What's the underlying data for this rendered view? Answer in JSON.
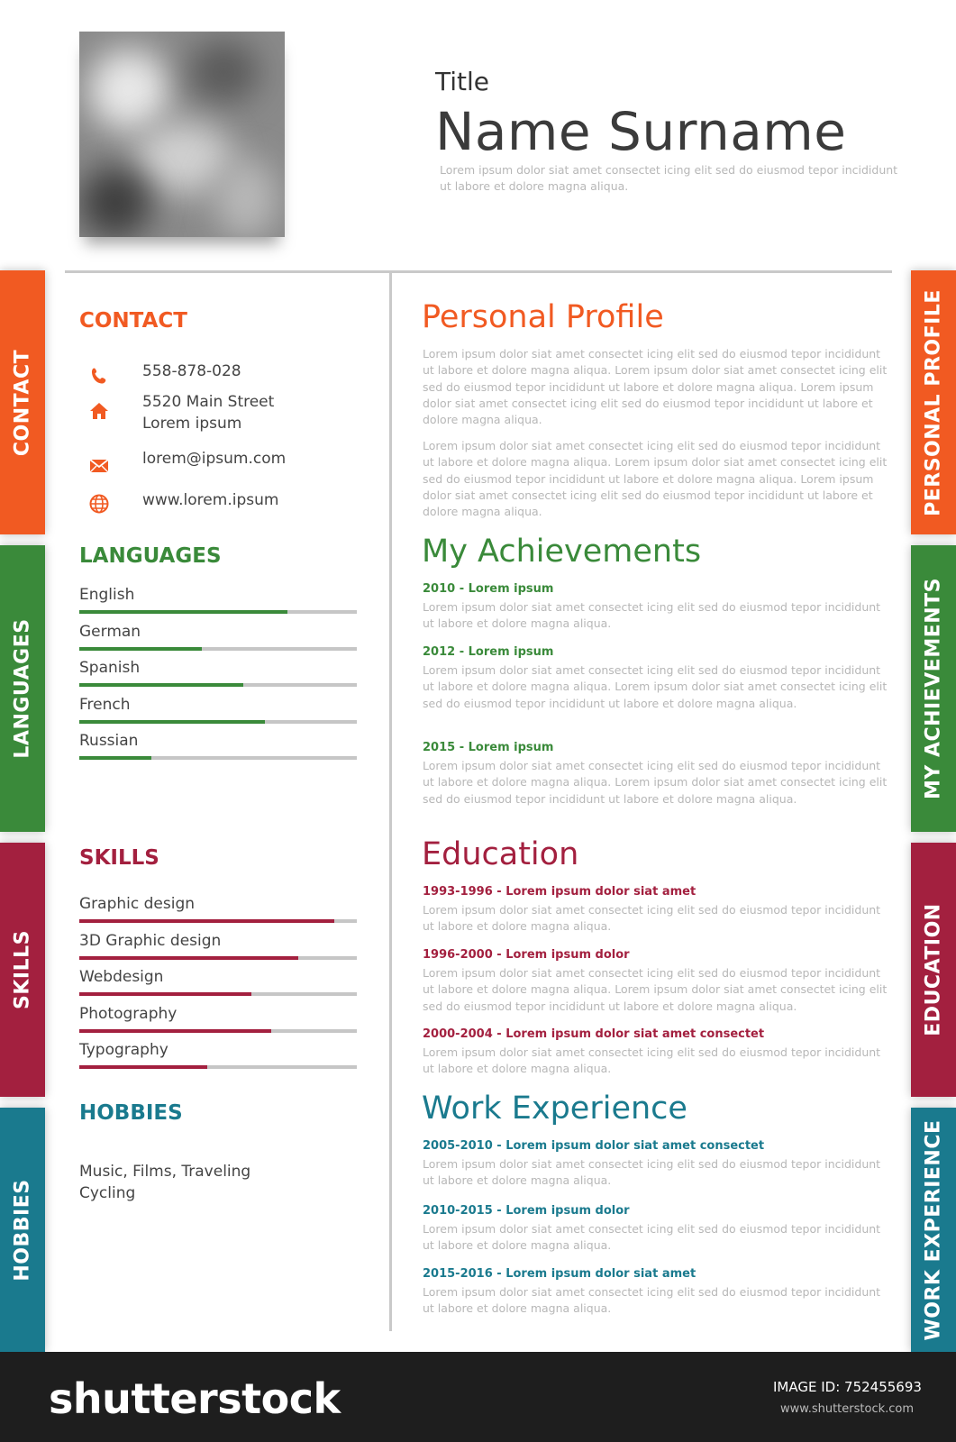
{
  "header": {
    "title": "Title",
    "name": "Name Surname",
    "intro": "Lorem ipsum dolor siat amet consectet  icing elit sed do eiusmod tepor incididunt ut labore et dolore magna aliqua."
  },
  "colors": {
    "contact": "#f15a22",
    "languages": "#3a8a3a",
    "skills": "#a3203f",
    "hobbies": "#1a7a8e",
    "divider": "#c9c9c9"
  },
  "tabs": {
    "left": [
      "CONTACT",
      "LANGUAGES",
      "SKILLS",
      "HOBBIES"
    ],
    "right": [
      "PERSONAL PROFILE",
      "MY ACHIEVEMENTS",
      "EDUCATION",
      "WORK EXPERIENCE"
    ]
  },
  "contact": {
    "heading": "CONTACT",
    "phone": "558-878-028",
    "address_line1": "5520 Main Street",
    "address_line2": "Lorem ipsum",
    "email": "lorem@ipsum.com",
    "web": "www.lorem.ipsum"
  },
  "languages": {
    "heading": "LANGUAGES",
    "items": [
      {
        "name": "English",
        "level": 0.75
      },
      {
        "name": "German",
        "level": 0.44
      },
      {
        "name": "Spanish",
        "level": 0.59
      },
      {
        "name": "French",
        "level": 0.67
      },
      {
        "name": "Russian",
        "level": 0.26
      }
    ]
  },
  "skills": {
    "heading": "SKILLS",
    "items": [
      {
        "name": "Graphic design",
        "level": 0.92
      },
      {
        "name": "3D Graphic design",
        "level": 0.79
      },
      {
        "name": "Webdesign",
        "level": 0.62
      },
      {
        "name": "Photography",
        "level": 0.69
      },
      {
        "name": "Typography",
        "level": 0.46
      }
    ]
  },
  "hobbies": {
    "heading": "HOBBIES",
    "line1": "Music, Films, Traveling",
    "line2": "Cycling"
  },
  "profile": {
    "heading": "Personal Profile",
    "para1": "Lorem ipsum dolor siat amet consectet  icing elit sed do eiusmod tepor incididunt ut labore et dolore magna aliqua. Lorem ipsum dolor siat amet consectet  icing elit sed do eiusmod tepor incididunt ut labore et dolore magna aliqua. Lorem ipsum dolor siat amet consectet  icing elit sed do eiusmod tepor incididunt ut labore et dolore magna aliqua.",
    "para2": "Lorem ipsum dolor siat amet consectet  icing elit sed do eiusmod tepor incididunt ut labore et dolore magna aliqua. Lorem ipsum dolor siat amet consectet  icing elit sed do eiusmod tepor incididunt ut labore et dolore magna aliqua. Lorem ipsum dolor siat amet consectet  icing elit sed do eiusmod tepor incididunt ut labore et dolore magna aliqua."
  },
  "achievements": {
    "heading": "My Achievements",
    "entries": [
      {
        "title": "2010 - Lorem ipsum",
        "text": "Lorem ipsum dolor siat amet consectet  icing elit sed do eiusmod tepor incididunt ut labore et dolore magna aliqua."
      },
      {
        "title": "2012 - Lorem ipsum",
        "text": "Lorem ipsum dolor siat amet consectet  icing elit sed do eiusmod tepor incididunt ut labore et dolore magna aliqua. Lorem ipsum dolor siat amet consectet  icing elit sed do eiusmod tepor incididunt ut labore et dolore magna aliqua."
      },
      {
        "title": "2015 - Lorem ipsum",
        "text": "Lorem ipsum dolor siat amet consectet  icing elit sed do eiusmod tepor incididunt ut labore et dolore magna aliqua. Lorem ipsum dolor siat amet consectet  icing elit sed do eiusmod tepor incididunt ut labore et dolore magna aliqua."
      }
    ]
  },
  "education": {
    "heading": "Education",
    "entries": [
      {
        "title": "1993-1996  -  Lorem ipsum dolor siat amet",
        "text": "Lorem ipsum dolor siat amet consectet  icing elit sed do eiusmod tepor incididunt ut labore et dolore magna aliqua."
      },
      {
        "title": "1996-2000  -  Lorem ipsum dolor",
        "text": "Lorem ipsum dolor siat amet consectet  icing elit sed do eiusmod tepor incididunt ut labore et dolore magna aliqua. Lorem ipsum dolor siat amet consectet  icing elit sed do eiusmod tepor incididunt ut labore et dolore magna aliqua."
      },
      {
        "title": "2000-2004  -  Lorem ipsum dolor siat amet consectet",
        "text": "Lorem ipsum dolor siat amet consectet  icing elit sed do eiusmod tepor incididunt ut labore et dolore magna aliqua."
      }
    ]
  },
  "work": {
    "heading": "Work Experience",
    "entries": [
      {
        "title": "2005-2010  -  Lorem ipsum dolor siat amet consectet",
        "text": "Lorem ipsum dolor siat amet consectet  icing elit sed do eiusmod tepor incididunt ut labore et dolore magna aliqua."
      },
      {
        "title": "2010-2015  -  Lorem ipsum dolor",
        "text": "Lorem ipsum dolor siat amet consectet  icing elit sed do eiusmod tepor incididunt ut labore et dolore magna aliqua."
      },
      {
        "title": "2015-2016  -  Lorem ipsum dolor siat amet",
        "text": "Lorem ipsum dolor siat amet consectet  icing elit sed do eiusmod tepor incididunt ut labore et dolore magna aliqua."
      }
    ]
  },
  "footer": {
    "brand": "shutterstock",
    "image_id": "IMAGE ID: 752455693",
    "url": "www.shutterstock.com"
  }
}
